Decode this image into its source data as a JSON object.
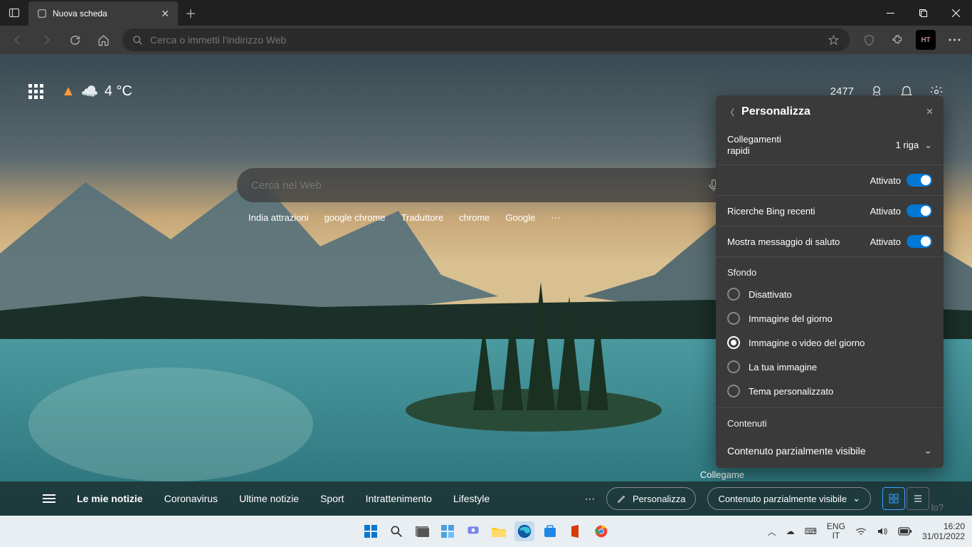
{
  "tab": {
    "title": "Nuova scheda"
  },
  "address": {
    "placeholder": "Cerca o immetti l'indirizzo Web"
  },
  "profile_initials": "HT",
  "ntp": {
    "temperature": "4 °C",
    "rewards_points": "2477",
    "search_placeholder": "Cerca nel Web",
    "quicklinks": [
      "India attrazioni",
      "google chrome",
      "Traduttore",
      "chrome",
      "Google"
    ],
    "collegamenti_label": "Collegame"
  },
  "panel": {
    "title": "Personalizza",
    "quick_links": {
      "label": "Collegamenti rapidi",
      "value": "1 riga"
    },
    "toggle_blank": {
      "status": "Attivato"
    },
    "recent_bing": {
      "label": "Ricerche Bing recenti",
      "status": "Attivato"
    },
    "greeting": {
      "label": "Mostra messaggio di saluto",
      "status": "Attivato"
    },
    "background_section": "Sfondo",
    "bg_options": {
      "off": "Disattivato",
      "image_day": "Immagine del giorno",
      "image_video_day": "Immagine o video del giorno",
      "your_image": "La tua immagine",
      "custom_theme": "Tema personalizzato"
    },
    "content_section": "Contenuti",
    "content_value": "Contenuto parzialmente visibile"
  },
  "newsbar": {
    "title": "Le mie notizie",
    "items": [
      "Coronavirus",
      "Ultime notizie",
      "Sport",
      "Intrattenimento",
      "Lifestyle"
    ],
    "personalize": "Personalizza",
    "content_mode": "Contenuto parzialmente visibile"
  },
  "taskbar": {
    "lang_top": "ENG",
    "lang_bottom": "IT",
    "time": "16:20",
    "date": "31/01/2022"
  },
  "help_tip": "lo?"
}
